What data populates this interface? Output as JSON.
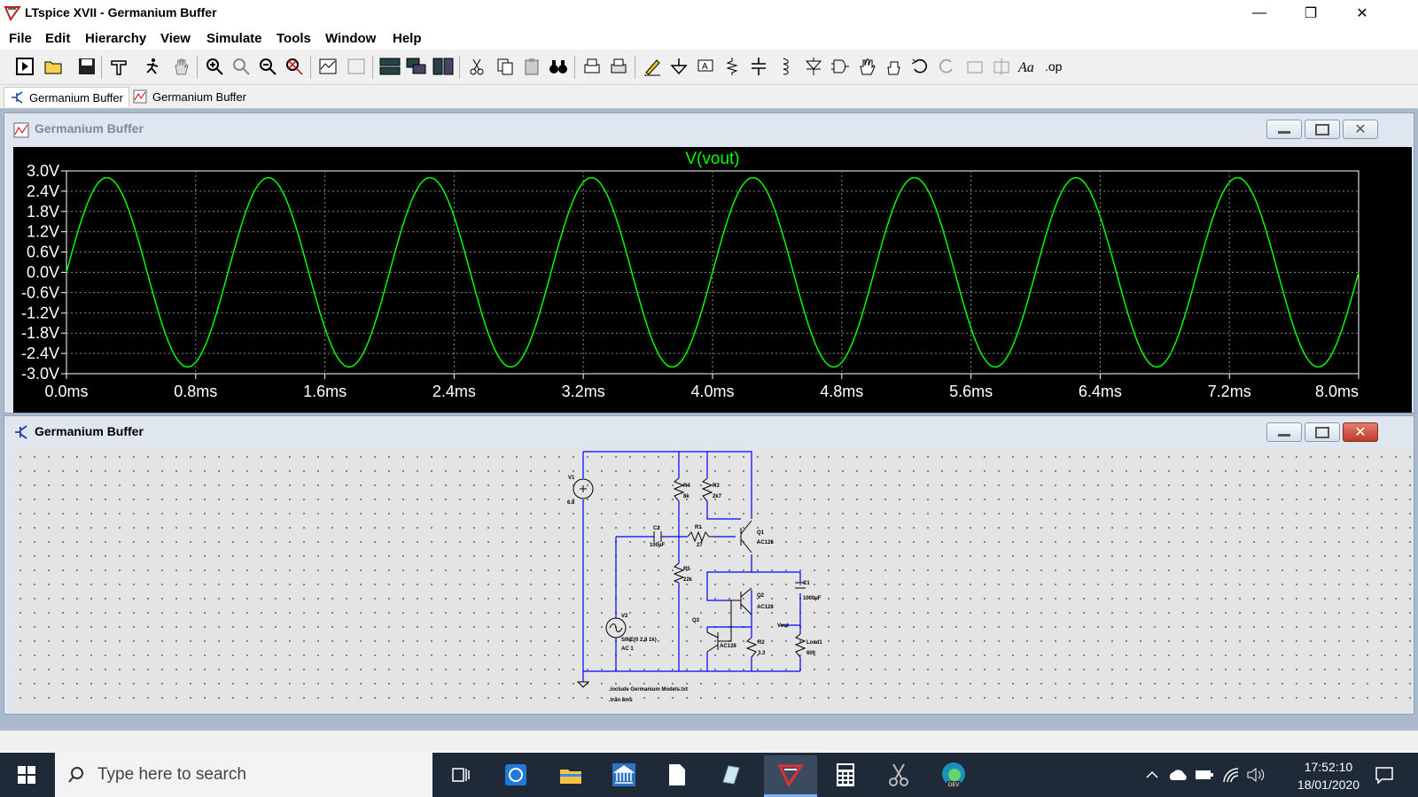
{
  "window": {
    "title": "LTspice XVII - Germanium Buffer"
  },
  "menu": [
    "File",
    "Edit",
    "Hierarchy",
    "View",
    "Simulate",
    "Tools",
    "Window",
    "Help"
  ],
  "tabs": [
    {
      "label": "Germanium Buffer",
      "icon": "schematic-icon",
      "active": true
    },
    {
      "label": "Germanium Buffer",
      "icon": "waveform-icon",
      "active": false
    }
  ],
  "plot_window": {
    "title": "Germanium Buffer"
  },
  "schematic_window": {
    "title": "Germanium Buffer"
  },
  "chart_data": {
    "type": "line",
    "title": "V(vout)",
    "xlim": [
      0,
      8
    ],
    "ylim": [
      -3.0,
      3.0
    ],
    "x_ticks": [
      "0.0ms",
      "0.8ms",
      "1.6ms",
      "2.4ms",
      "3.2ms",
      "4.0ms",
      "4.8ms",
      "5.6ms",
      "6.4ms",
      "7.2ms",
      "8.0ms"
    ],
    "y_ticks": [
      "3.0V",
      "2.4V",
      "1.8V",
      "1.2V",
      "0.6V",
      "0.0V",
      "-0.6V",
      "-1.2V",
      "-1.8V",
      "-2.4V",
      "-3.0V"
    ],
    "series": [
      {
        "name": "V(vout)",
        "color": "#00ff00",
        "waveform": "sine",
        "amplitude_v": 2.8,
        "frequency_khz": 1,
        "offset_v": 0
      }
    ],
    "grid": true,
    "background": "#000000"
  },
  "schematic": {
    "labels": {
      "v1": "V1",
      "v1_val": "6.8",
      "r4": "R4",
      "r4_val": "8k",
      "r3": "R3",
      "r3_val": "2k7",
      "q1": "Q1",
      "q1_val": "AC128",
      "c2": "C2",
      "c2_val": "100µF",
      "r1": "R1",
      "r1_val": "27",
      "r5": "R5",
      "r5_val": "22k",
      "c1": "C1",
      "c1_val": "1000µF",
      "q2": "Q2",
      "q2_val": "AC128",
      "v2": "V2",
      "v2_val1": "SINE(0 2.8 1k)",
      "v2_val2": "AC 1",
      "q3": "Q3",
      "q3_val": "AC128",
      "r2": "R2",
      "r2_val": "3.3",
      "vout": "Vout",
      "load": "Load1",
      "load_val": "600",
      "directive1": ".include Germanium Models.txt",
      "directive2": ".tran 8ms"
    }
  },
  "taskbar": {
    "search_placeholder": "Type here to search",
    "time": "17:52:10",
    "date": "18/01/2020"
  },
  "colors": {
    "trace": "#00ff00",
    "wire": "#0000ff",
    "plot_bg": "#000000"
  }
}
